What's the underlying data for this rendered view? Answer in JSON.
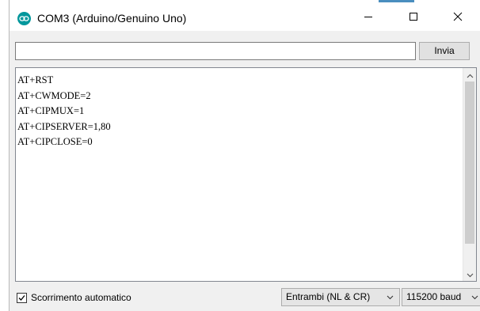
{
  "window": {
    "title": "COM3 (Arduino/Genuino Uno)",
    "icon": "arduino-logo-icon",
    "controls": [
      "minimize-icon",
      "maximize-icon",
      "close-icon"
    ]
  },
  "send": {
    "input_value": "",
    "button_label": "Invia"
  },
  "output": {
    "lines": [
      "AT+RST",
      "AT+CWMODE=2",
      "AT+CIPMUX=1",
      "AT+CIPSERVER=1,80",
      "AT+CIPCLOSE=0"
    ]
  },
  "footer": {
    "autoscroll_label": "Scorrimento automatico",
    "autoscroll_checked": true,
    "line_ending": "Entrambi (NL & CR)",
    "baud_rate": "115200 baud"
  },
  "colors": {
    "accent": "#00979c",
    "window_bg": "#f0f0f0"
  }
}
